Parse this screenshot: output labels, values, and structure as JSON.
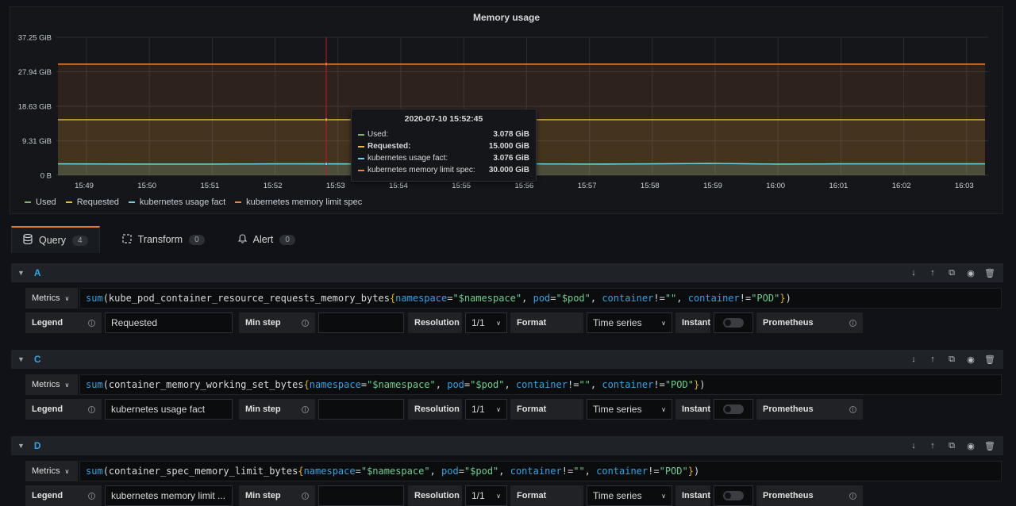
{
  "panel": {
    "title": "Memory usage"
  },
  "tooltip": {
    "time": "2020-07-10 15:52:45",
    "rows": [
      {
        "name": "Used:",
        "value": "3.078 GiB",
        "color": "#7eb26d"
      },
      {
        "name": "Requested:",
        "value": "15.000 GiB",
        "color": "#eab839"
      },
      {
        "name": "kubernetes usage fact:",
        "value": "3.076 GiB",
        "color": "#6ed0e0"
      },
      {
        "name": "kubernetes memory limit spec:",
        "value": "30.000 GiB",
        "color": "#ef843c"
      }
    ]
  },
  "chart_data": {
    "type": "area",
    "title": "Memory usage",
    "y_ticks": [
      "37.25 GiB",
      "27.94 GiB",
      "18.63 GiB",
      "9.31 GiB",
      "0 B"
    ],
    "ylim": [
      0,
      37.25
    ],
    "x_ticks": [
      "15:49",
      "15:50",
      "15:51",
      "15:52",
      "15:53",
      "15:54",
      "15:55",
      "15:56",
      "15:57",
      "15:58",
      "15:59",
      "16:00",
      "16:01",
      "16:02",
      "16:03"
    ],
    "series": [
      {
        "name": "Used",
        "color": "#7eb26d",
        "values": [
          3.1,
          3.0,
          3.0,
          3.1,
          3.08,
          3.0,
          3.0,
          3.1,
          3.0,
          3.1,
          3.2,
          3.0,
          3.1,
          3.1,
          3.1
        ]
      },
      {
        "name": "Requested",
        "color": "#eab839",
        "values": [
          15,
          15,
          15,
          15,
          15,
          15,
          15,
          15,
          15,
          15,
          15,
          15,
          15,
          15,
          15
        ]
      },
      {
        "name": "kubernetes usage fact",
        "color": "#6ed0e0",
        "values": [
          3.1,
          3.0,
          3.0,
          3.1,
          3.076,
          3.0,
          3.0,
          3.1,
          3.0,
          3.1,
          3.2,
          3.0,
          3.1,
          3.1,
          3.1
        ]
      },
      {
        "name": "kubernetes memory limit spec",
        "color": "#ef843c",
        "values": [
          30,
          30,
          30,
          30,
          30,
          30,
          30,
          30,
          30,
          30,
          30,
          30,
          30,
          30,
          30
        ]
      }
    ],
    "legend": "bottom"
  },
  "tabs": [
    {
      "label": "Query",
      "count": "4",
      "icon": "database-icon"
    },
    {
      "label": "Transform",
      "count": "0",
      "icon": "transform-icon"
    },
    {
      "label": "Alert",
      "count": "0",
      "icon": "bell-icon"
    }
  ],
  "queries": [
    {
      "letter": "A",
      "metrics_label": "Metrics",
      "expr": {
        "fn": "sum",
        "metric": "kube_pod_container_resource_requests_memory_bytes",
        "l1": "namespace",
        "v1": "\"$namespace\"",
        "l2": "pod",
        "v2": "\"$pod\"",
        "l3": "container",
        "v3": "\"\"",
        "l4": "container",
        "v4": "\"POD\""
      },
      "legend_label": "Legend",
      "legend_value": "Requested",
      "minstep_label": "Min step",
      "minstep_value": "",
      "resolution_label": "Resolution",
      "resolution_value": "1/1",
      "format_label": "Format",
      "format_value": "Time series",
      "instant_label": "Instant",
      "source_label": "Prometheus"
    },
    {
      "letter": "C",
      "metrics_label": "Metrics",
      "expr": {
        "fn": "sum",
        "metric": "container_memory_working_set_bytes",
        "l1": "namespace",
        "v1": "\"$namespace\"",
        "l2": "pod",
        "v2": "\"$pod\"",
        "l3": "container",
        "v3": "\"\"",
        "l4": "container",
        "v4": "\"POD\""
      },
      "legend_label": "Legend",
      "legend_value": "kubernetes usage fact",
      "minstep_label": "Min step",
      "minstep_value": "",
      "resolution_label": "Resolution",
      "resolution_value": "1/1",
      "format_label": "Format",
      "format_value": "Time series",
      "instant_label": "Instant",
      "source_label": "Prometheus"
    },
    {
      "letter": "D",
      "metrics_label": "Metrics",
      "expr": {
        "fn": "sum",
        "metric": "container_spec_memory_limit_bytes",
        "l1": "namespace",
        "v1": "\"$namespace\"",
        "l2": "pod",
        "v2": "\"$pod\"",
        "l3": "container",
        "v3": "\"\"",
        "l4": "container",
        "v4": "\"POD\""
      },
      "legend_label": "Legend",
      "legend_value": "kubernetes memory limit ...",
      "minstep_label": "Min step",
      "minstep_value": "",
      "resolution_label": "Resolution",
      "resolution_value": "1/1",
      "format_label": "Format",
      "format_value": "Time series",
      "instant_label": "Instant",
      "source_label": "Prometheus"
    }
  ]
}
